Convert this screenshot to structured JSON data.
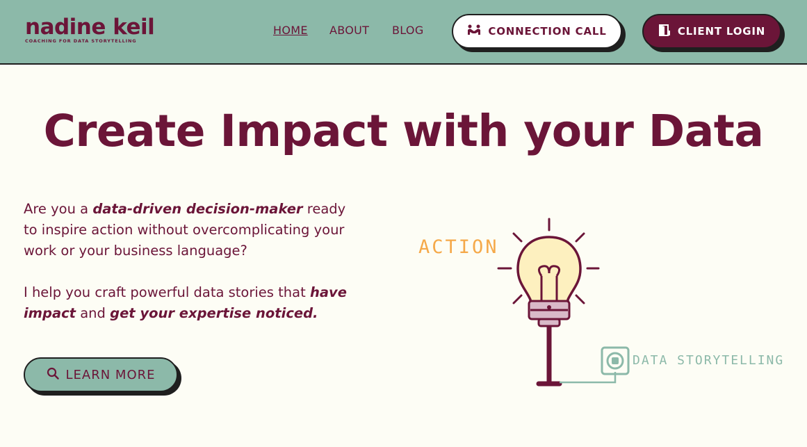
{
  "brand": {
    "name": "nadine keil",
    "tagline": "COACHING FOR DATA STORYTELLING"
  },
  "nav": {
    "home": "HOME",
    "about": "ABOUT",
    "blog": "BLOG"
  },
  "cta": {
    "connection_call": "CONNECTION CALL",
    "client_login": "CLIENT LOGIN",
    "learn_more": "LEARN  MORE"
  },
  "hero": {
    "title": "Create Impact with your Data",
    "p1_a": "Are you a ",
    "p1_b": "data-driven decision-maker",
    "p1_c": " ready to inspire action without overcomplicating your work or your business language?",
    "p2_a": "I help you craft powerful data stories that ",
    "p2_b": "have impact",
    "p2_c": " and ",
    "p2_d": "get your expertise noticed."
  },
  "illustration": {
    "action_label": "ACTION",
    "storytelling_label": "DATA STORYTELLING"
  },
  "colors": {
    "header_bg": "#8cb9a9",
    "brand": "#6b1538",
    "page_bg": "#fdfdf5",
    "accent": "#f5a94a"
  },
  "icons": {
    "connection_call": "people-connect-icon",
    "client_login": "door-icon",
    "learn_more": "search-icon"
  }
}
